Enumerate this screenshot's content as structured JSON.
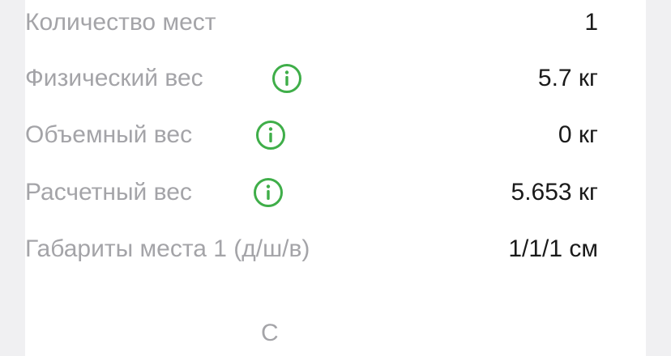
{
  "details": {
    "rows": [
      {
        "label": "Количество мест",
        "value": "1"
      },
      {
        "label": "Физический вес",
        "value": "5.7 кг",
        "icon": "info-icon"
      },
      {
        "label": "Объемный вес",
        "value": "0 кг",
        "icon": "info-icon"
      },
      {
        "label": "Расчетный вес",
        "value": "5.653 кг",
        "icon": "info-icon"
      },
      {
        "label": "Габариты места 1 (д/ш/в)",
        "value": "1/1/1 см"
      }
    ]
  },
  "colors": {
    "accent": "#3fae49",
    "label": "#a4a4a8",
    "value": "#1a1a1a",
    "background": "#f0f0f2",
    "card": "#ffffff"
  },
  "footer": {
    "cut_text": "С"
  }
}
